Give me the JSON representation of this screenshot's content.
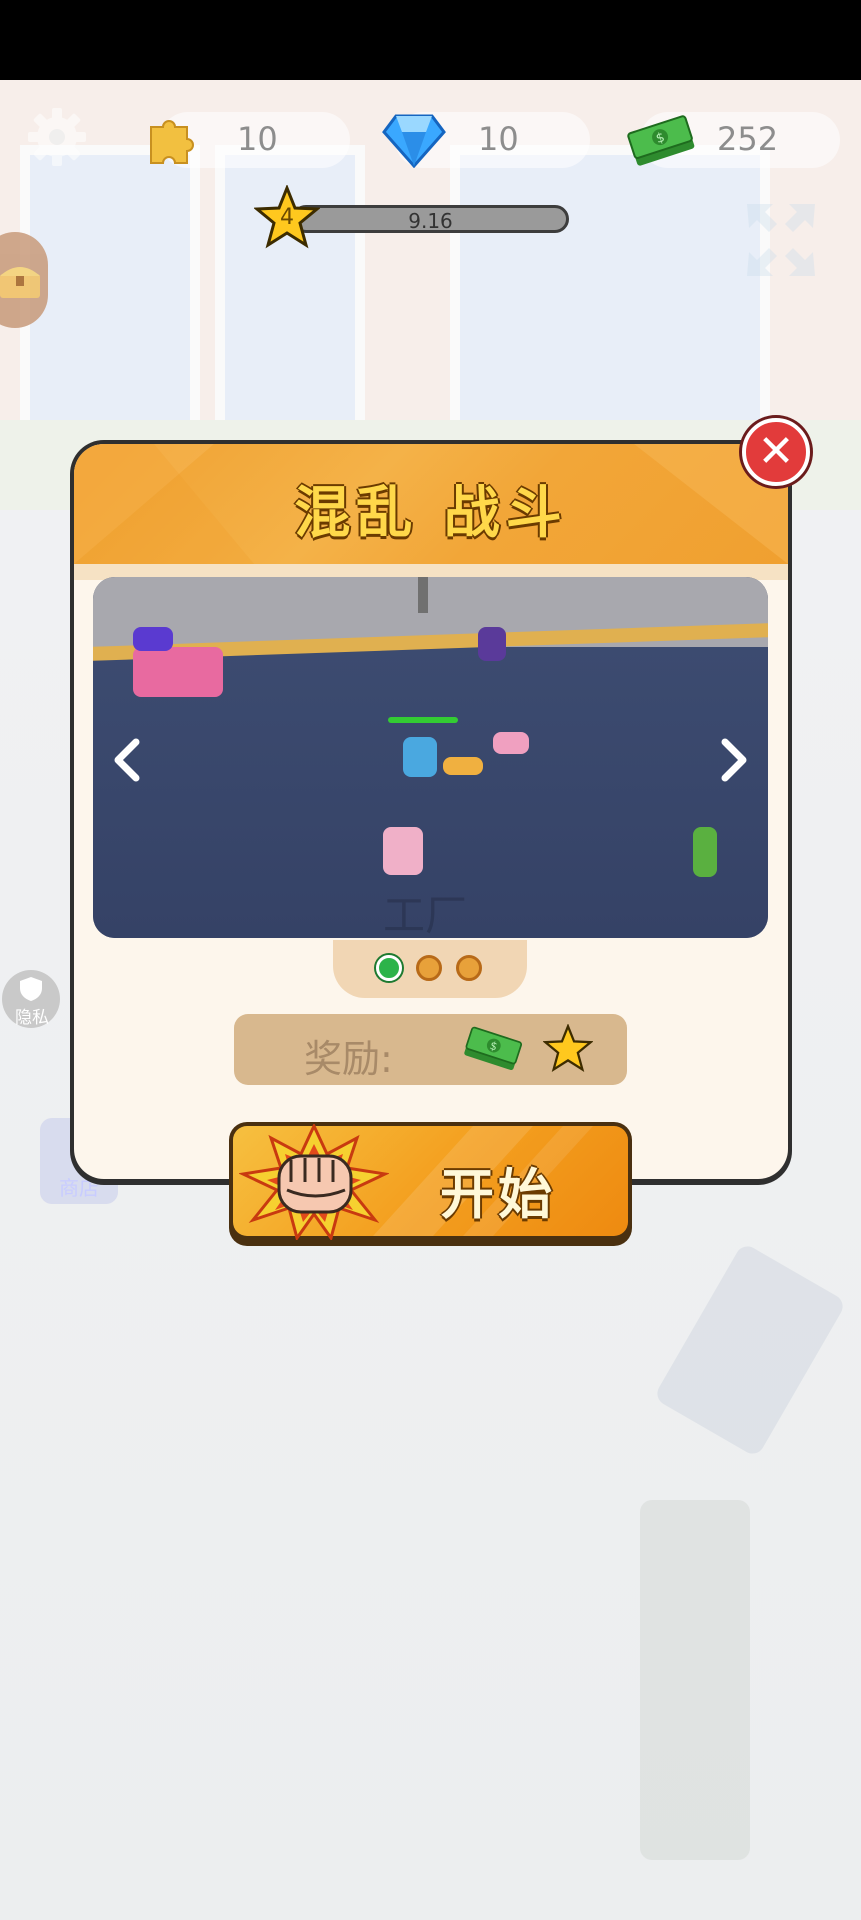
{
  "hud": {
    "puzzle_count": "10",
    "gem_count": "10",
    "cash_count": "252",
    "level": "4",
    "xp_value": "9.16",
    "xp_progress": 0.02
  },
  "side": {
    "privacy_label": "隐私",
    "shop_label": "商店"
  },
  "dialog": {
    "title": "混乱 战斗",
    "preview_caption": "工厂",
    "page_dots": [
      {
        "active": true,
        "color": "#2cb34a"
      },
      {
        "active": false,
        "color": "#e8a13a"
      },
      {
        "active": false,
        "color": "#e8a13a"
      }
    ],
    "reward_label": "奖励:",
    "reward_icons": [
      "cash-stack-icon",
      "star-icon"
    ],
    "start_label": "开始",
    "close_symbol": "✕"
  },
  "colors": {
    "panel_header": "#f2a638",
    "close_button": "#e23b3b",
    "start_button": "#f4a020",
    "active_dot": "#2cb34a"
  }
}
